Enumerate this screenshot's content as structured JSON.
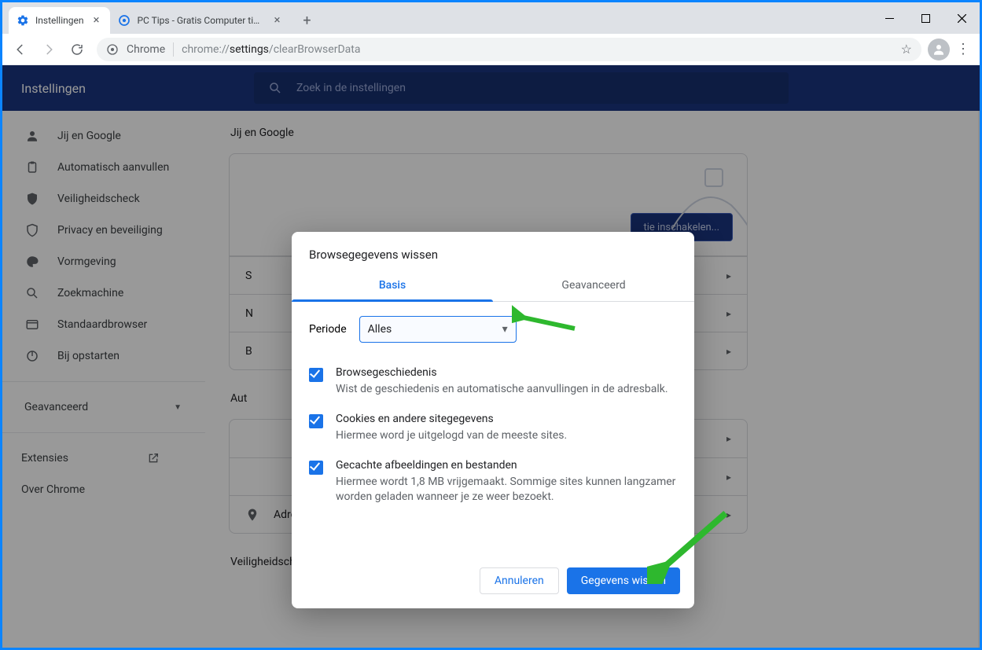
{
  "tabs": [
    {
      "title": "Instellingen",
      "active": true
    },
    {
      "title": "PC Tips - Gratis Computer tips, in",
      "active": false
    }
  ],
  "omnibox": {
    "scheme_label": "Chrome",
    "url_prefix": "chrome://",
    "url_mid": "settings",
    "url_suffix": "/clearBrowserData"
  },
  "page": {
    "title": "Instellingen",
    "search_placeholder": "Zoek in de instellingen"
  },
  "sidebar": {
    "items": [
      {
        "label": "Jij en Google",
        "icon": "person"
      },
      {
        "label": "Automatisch aanvullen",
        "icon": "clipboard"
      },
      {
        "label": "Veiligheidscheck",
        "icon": "shield-check"
      },
      {
        "label": "Privacy en beveiliging",
        "icon": "shield"
      },
      {
        "label": "Vormgeving",
        "icon": "palette"
      },
      {
        "label": "Zoekmachine",
        "icon": "search"
      },
      {
        "label": "Standaardbrowser",
        "icon": "browser"
      },
      {
        "label": "Bij opstarten",
        "icon": "power"
      }
    ],
    "advanced": "Geavanceerd",
    "extensions": "Extensies",
    "about": "Over Chrome"
  },
  "main": {
    "section1": "Jij en Google",
    "sync_button": "tie inschakelen...",
    "row_s": "S",
    "row_n": "N",
    "row_b": "B",
    "section2": "Aut",
    "row_addr": "Adressen en meer",
    "section3": "Veiligheidscheck"
  },
  "dialog": {
    "title": "Browsegegevens wissen",
    "tabs": {
      "basic": "Basis",
      "advanced": "Geavanceerd"
    },
    "period_label": "Periode",
    "period_value": "Alles",
    "options": [
      {
        "title": "Browsegeschiedenis",
        "sub": "Wist de geschiedenis en automatische aanvullingen in de adresbalk."
      },
      {
        "title": "Cookies en andere sitegegevens",
        "sub": "Hiermee word je uitgelogd van de meeste sites."
      },
      {
        "title": "Gecachte afbeeldingen en bestanden",
        "sub": "Hiermee wordt 1,8 MB vrijgemaakt. Sommige sites kunnen langzamer worden geladen wanneer je ze weer bezoekt."
      }
    ],
    "cancel": "Annuleren",
    "confirm": "Gegevens wissen"
  }
}
